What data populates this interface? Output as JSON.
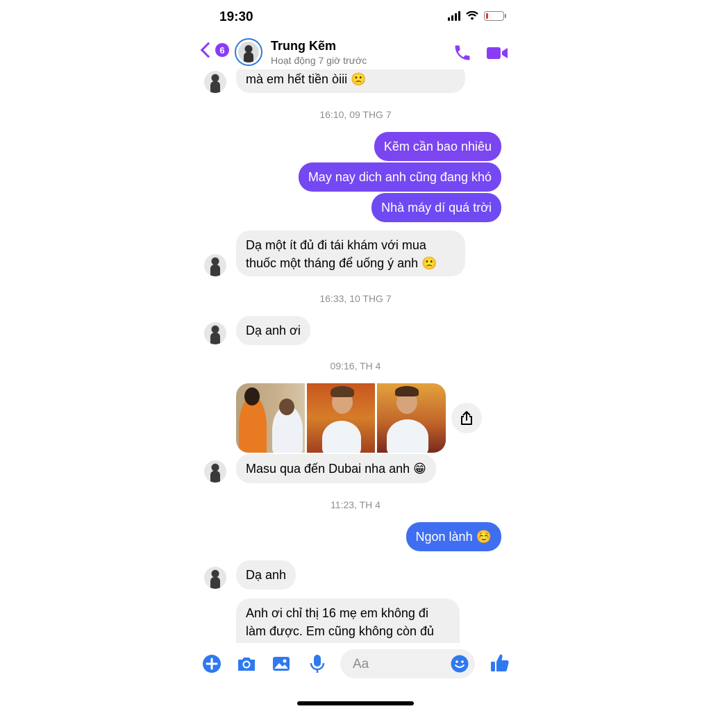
{
  "status_bar": {
    "time": "19:30"
  },
  "header": {
    "back_badge": "6",
    "contact_name": "Trung Kẽm",
    "activity": "Hoạt động 7 giờ trước",
    "accent_color": "#8a3cf5"
  },
  "messages": {
    "m0": "mà em hết tiền òiii 🙁",
    "ts1": "16:10, 09 THG 7",
    "o1": "Kẽm cần bao nhiêu",
    "o2": "May nay dich anh cũng đang khó",
    "o3": "Nhà máy dí quá trời",
    "m1": "Dạ một ít đủ đi tái khám với mua thuốc một tháng để uống ý anh 🙁",
    "ts2": "16:33, 10 THG 7",
    "m2": "Dạ anh ơi",
    "ts3": "09:16, TH 4",
    "m3": "Masu qua đến Dubai nha anh 😁",
    "ts4": "11:23, TH 4",
    "o4": "Ngon lành ☺️",
    "m4": "Dạ anh",
    "m5": "Anh ơi chỉ thị 16 mẹ em không đi làm được. Em cũng không còn đủ"
  },
  "colors": {
    "outgoing_purple": "#7b45f0",
    "outgoing_blue": "#3f6ff0",
    "incoming": "#efefef",
    "composer_icon": "#2f79f0"
  },
  "composer": {
    "placeholder": "Aa"
  },
  "icons": [
    "back-chevron-icon",
    "phone-icon",
    "video-icon",
    "share-icon",
    "plus-icon",
    "camera-icon",
    "image-icon",
    "microphone-icon",
    "emoji-icon",
    "thumbs-up-icon"
  ]
}
